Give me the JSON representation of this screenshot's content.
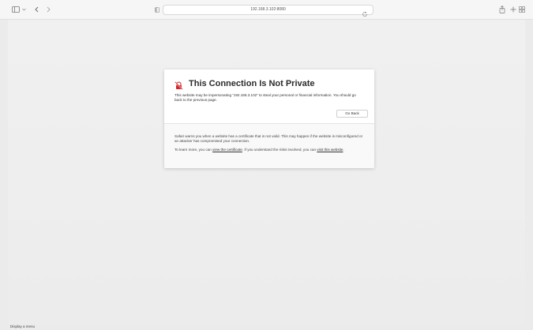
{
  "toolbar": {
    "icons": {
      "sidebar": "sidebar-icon",
      "chevron": "chevron-down-icon",
      "back": "back-icon",
      "forward": "forward-icon",
      "privacy": "privacy-icon",
      "reload": "reload-icon",
      "share": "share-icon",
      "new_tab": "plus-icon",
      "tab_overview": "tab-overview-icon"
    },
    "address": "192.168.3.102:8080"
  },
  "dialog": {
    "title": "This Connection Is Not Private",
    "body": "This website may be impersonating “192.168.3.102” to steal your personal or financial information. You should go back to the previous page.",
    "go_back_label": "Go Back",
    "para1": "Safari warns you when a website has a certificate that is not valid. This may happen if the website is misconfigured or an attacker has compromised your connection.",
    "para2_prefix": "To learn more, you can ",
    "view_certificate_link": "view the certificate",
    "para2_middle": ". If you understand the risks involved, you can ",
    "visit_website_link": "visit this website",
    "para2_suffix": ".",
    "warning_icon": "not-private-lock-icon",
    "accent_color": "#d2252b"
  },
  "status_bar": {
    "text": "Display a menu"
  }
}
